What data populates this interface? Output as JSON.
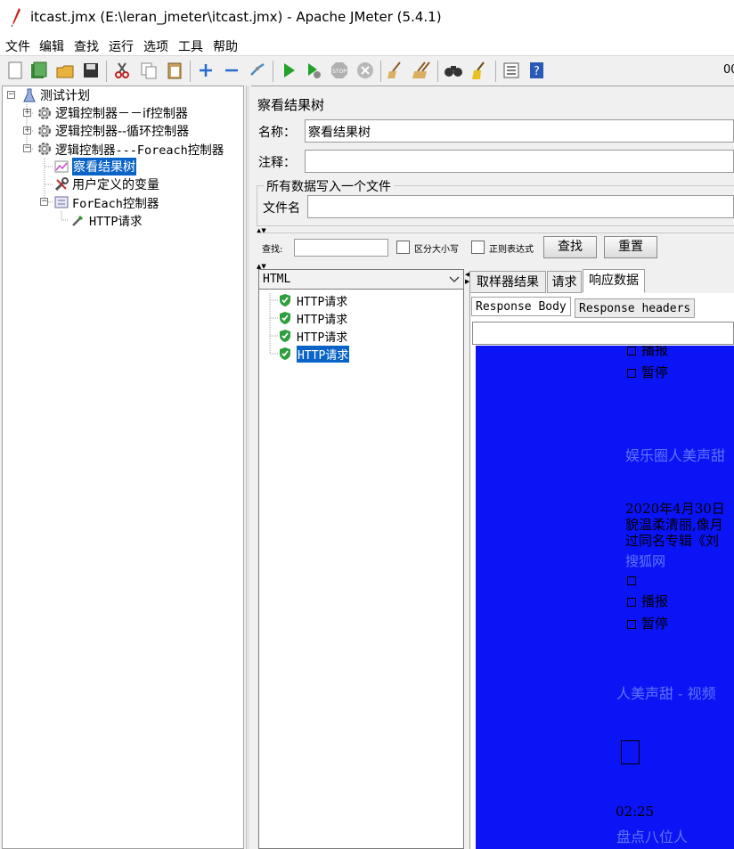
{
  "window": {
    "title": "itcast.jmx (E:\\leran_jmeter\\itcast.jmx) - Apache JMeter (5.4.1)"
  },
  "menu": [
    "文件",
    "编辑",
    "查找",
    "运行",
    "选项",
    "工具",
    "帮助"
  ],
  "toolbar": {
    "icons": [
      "new-icon",
      "templates-icon",
      "open-icon",
      "save-icon",
      "cut-icon",
      "copy-icon",
      "paste-icon",
      "expand-icon",
      "collapse-icon",
      "toggle-icon",
      "start-icon",
      "start-no-pause-icon",
      "stop-icon",
      "shutdown-icon",
      "clear-icon",
      "clear-all-icon",
      "search-icon",
      "reset-search-icon",
      "function-helper-icon",
      "help-icon"
    ],
    "counter": "00"
  },
  "tree": {
    "items": [
      {
        "label": "测试计划",
        "icon": "test-plan-icon"
      },
      {
        "label": "逻辑控制器－－if控制器",
        "icon": "gear-icon"
      },
      {
        "label": "逻辑控制器--循环控制器",
        "icon": "gear-icon"
      },
      {
        "label": "逻辑控制器---Foreach控制器",
        "icon": "gear-icon"
      },
      {
        "label": "察看结果树",
        "icon": "chart-icon"
      },
      {
        "label": "用户定义的变量",
        "icon": "wrench-icon"
      },
      {
        "label": "ForEach控制器",
        "icon": "controller-icon"
      },
      {
        "label": "HTTP请求",
        "icon": "pipette-icon"
      }
    ]
  },
  "panel": {
    "title": "察看结果树",
    "name_label": "名称：",
    "name_value": "察看结果树",
    "comment_label": "注释：",
    "comment_value": "",
    "file_group_title": "所有数据写入一个文件",
    "file_label": "文件名",
    "file_value": ""
  },
  "search": {
    "label": "查找:",
    "value": "",
    "case_label": "区分大小写",
    "regex_label": "正则表达式",
    "find_button": "查找",
    "reset_button": "重置"
  },
  "results": {
    "renderer": "HTML",
    "items": [
      "HTTP请求",
      "HTTP请求",
      "HTTP请求",
      "HTTP请求"
    ],
    "selected_index": 3
  },
  "tabs": [
    "取样器结果",
    "请求",
    "响应数据"
  ],
  "active_tab": 2,
  "subtabs": [
    "Response Body",
    "Response headers"
  ],
  "response": {
    "lines": [
      {
        "text": "播报",
        "box": true,
        "tone": "dark"
      },
      {
        "text": "暂停",
        "box": true,
        "tone": "dark"
      },
      {
        "text": "娱乐圈人美声甜",
        "box": false,
        "tone": "faint"
      },
      {
        "text": "2020年4月30日",
        "box": false,
        "tone": "dark"
      },
      {
        "text": "貌温柔清丽,像月",
        "box": false,
        "tone": "dark"
      },
      {
        "text": "过同名专辑《刘",
        "box": false,
        "tone": "dark"
      },
      {
        "text": "搜狐网",
        "box": false,
        "tone": "faint"
      },
      {
        "text": "",
        "box": true,
        "tone": "dark"
      },
      {
        "text": "播报",
        "box": true,
        "tone": "dark"
      },
      {
        "text": "暂停",
        "box": true,
        "tone": "dark"
      },
      {
        "text": "人美声甜 - 视频",
        "box": false,
        "tone": "faint"
      },
      {
        "text": "02:25",
        "box": false,
        "tone": "dark"
      },
      {
        "text": "盘点八位人",
        "box": false,
        "tone": "faint"
      }
    ]
  },
  "colors": {
    "selection": "#0a64c8",
    "render_background": "#0a14f5",
    "shield": "#2e9e3e"
  }
}
